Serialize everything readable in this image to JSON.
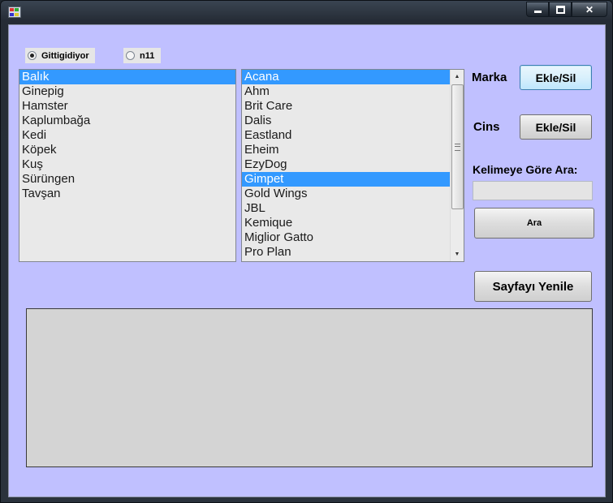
{
  "window": {
    "title": ""
  },
  "radios": [
    {
      "label": "Gittigidiyor",
      "checked": true
    },
    {
      "label": "n11",
      "checked": false
    }
  ],
  "categories": {
    "items": [
      "Balık",
      "Ginepig",
      "Hamster",
      "Kaplumbağa",
      "Kedi",
      "Köpek",
      "Kuş",
      "Sürüngen",
      "Tavşan"
    ],
    "selected": "Balık"
  },
  "brands": {
    "items": [
      "Acana",
      "Ahm",
      "Brit Care",
      "Dalis",
      "Eastland",
      "Eheim",
      "EzyDog",
      "Gimpet",
      "Gold Wings",
      "JBL",
      "Kemique",
      "Miglior Gatto",
      "Pro Plan"
    ],
    "selected": [
      "Acana",
      "Gimpet"
    ]
  },
  "marka": {
    "label": "Marka",
    "button": "Ekle/Sil"
  },
  "cins": {
    "label": "Cins",
    "button": "Ekle/Sil"
  },
  "search": {
    "label": "Kelimeye Göre Ara:",
    "value": "",
    "button": "Ara"
  },
  "refresh_button": "Sayfayı Yenile",
  "colors": {
    "background": "#c0c0ff",
    "selection": "#3399ff"
  }
}
